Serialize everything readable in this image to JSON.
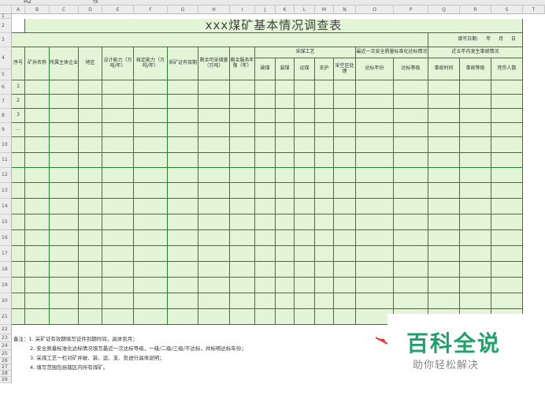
{
  "toolbar": {
    "namebox": "H2",
    "fx": "fx"
  },
  "columns": [
    "A",
    "B",
    "C",
    "D",
    "E",
    "F",
    "G",
    "H",
    "I",
    "J",
    "K",
    "L",
    "M",
    "N",
    "O",
    "P",
    "Q",
    "R",
    "S",
    "T"
  ],
  "rows": [
    "1",
    "2",
    "3",
    "4",
    "5",
    "6",
    "7",
    "8",
    "9",
    "10",
    "11",
    "12",
    "13",
    "14",
    "15",
    "16",
    "17",
    "18",
    "19",
    "20",
    "21",
    "22",
    "23",
    "24",
    "25",
    "26",
    "27",
    "28",
    "29"
  ],
  "sheet": {
    "title": "xxx煤矿基本情况调查表",
    "fill_date": "填写日期:  年  月  日",
    "headers": {
      "seq": "序号",
      "mine_name": "矿井名称",
      "owner": "所属主体企业",
      "region": "地区",
      "design_capacity": "设计能力（万吨/年）",
      "approved_capacity": "核定能力（万吨/年）",
      "license_valid": "采矿证有效期",
      "remaining_reserves": "剩余可采储量（万吨）",
      "remaining_years": "剩余服务年限（年）",
      "mining_process": "采煤工艺",
      "sub_mining": [
        "破煤",
        "装煤",
        "运煤",
        "支护",
        "采空区处理"
      ],
      "safety_standard": "最近一次安全质量标准化达标情况",
      "sub_safety": [
        "达标年份",
        "达标等级"
      ],
      "accidents": "近五年内发生事故情况",
      "sub_accidents": [
        "事故时间",
        "事故等级",
        "死伤人数"
      ]
    },
    "seq_values": [
      "1",
      "2",
      "3",
      "…"
    ]
  },
  "notes": [
    "备注：1. 采矿证有效期填写证件到期时间，具体到月；",
    "2. 安全质量标准化达标情况填写最近一次达标等级，一级/二级/三级/不达标，并标明达标年份；",
    "3. 采煤工艺一栏对矿井破、装、运、支、处进行具体说明；",
    "4. 填写范围包括辖区内所有煤矿。"
  ],
  "brand": {
    "main": "百科全说",
    "sub": "助你轻松解决"
  },
  "colors": {
    "grid": "#2e7d32",
    "fill": "#e3f5d6",
    "brand": "#22a06b",
    "arrow": "#e53935"
  }
}
